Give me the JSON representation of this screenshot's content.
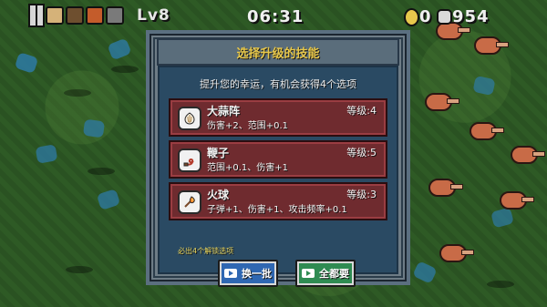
{
  "hud": {
    "level": "Lv8",
    "timer": "06:31",
    "gold": "0",
    "kills": "954"
  },
  "dialog": {
    "title": "选择升级的技能",
    "subtitle": "提升您的幸运，有机会获得4个选项",
    "options": [
      {
        "name": "大蒜阵",
        "level": "等级:4",
        "desc": "伤害+2、范围+0.1",
        "icon": "garlic-icon"
      },
      {
        "name": "鞭子",
        "level": "等级:5",
        "desc": "范围+0.1、伤害+1",
        "icon": "whip-icon"
      },
      {
        "name": "火球",
        "level": "等级:3",
        "desc": "子弹+1、伤害+1、攻击频率+0.1",
        "icon": "fireball-icon"
      }
    ],
    "unlock_hint": "必出4个解锁选项",
    "buttons": {
      "refresh_label": "换一批",
      "take_all_label": "全都要"
    }
  }
}
